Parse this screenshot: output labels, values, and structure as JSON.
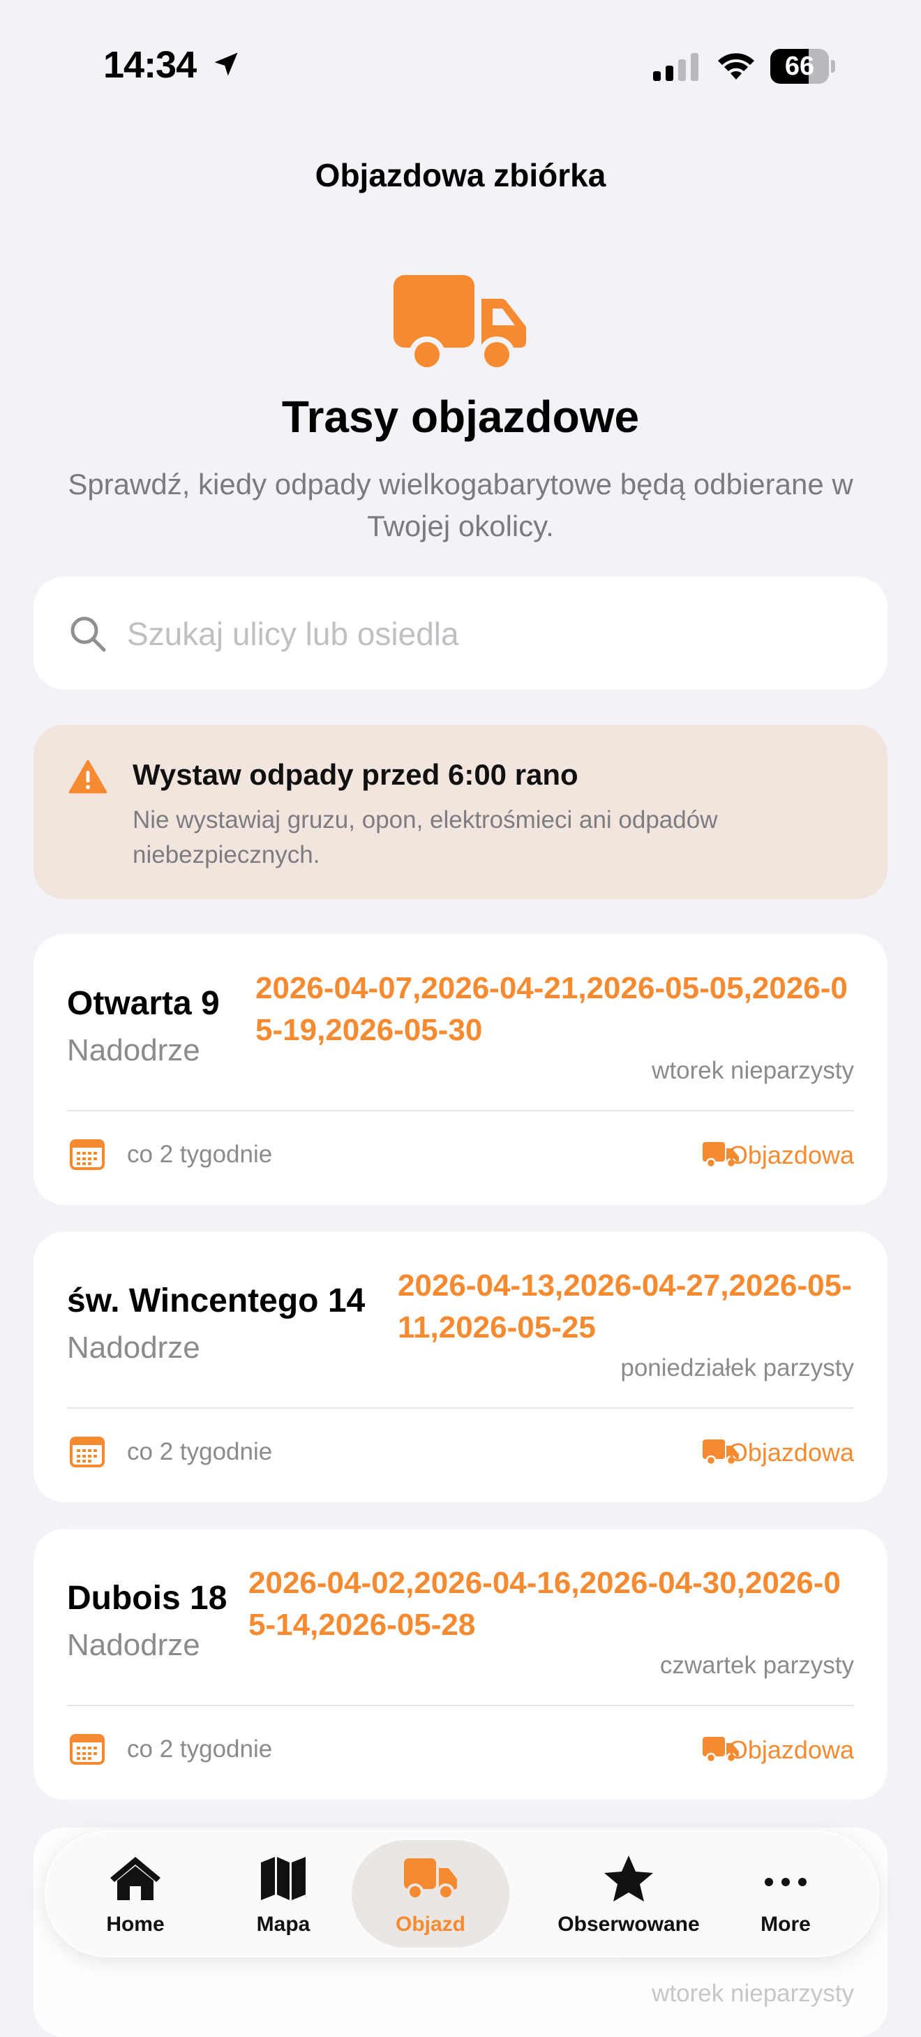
{
  "status": {
    "time": "14:34",
    "battery": "66",
    "battery_level": 0.66
  },
  "header": {
    "nav_title": "Objazdowa zbiórka",
    "hero_title": "Trasy objazdowe",
    "hero_subtitle": "Sprawdź, kiedy odpady wielkogabarytowe będą odbierane w Twojej okolicy."
  },
  "search": {
    "placeholder": "Szukaj ulicy lub osiedla",
    "value": ""
  },
  "warning": {
    "title": "Wystaw odpady przed 6:00 rano",
    "body": "Nie wystawiaj gruzu, opon, elektrośmieci ani odpadów niebezpiecznych."
  },
  "cards": [
    {
      "street": "Otwarta 9",
      "district": "Nadodrze",
      "dates": "2026-04-07,2026-04-21,2026-05-05,2026-05-19,2026-05-30",
      "day": "wtorek nieparzysty",
      "frequency": "co 2 tygodnie",
      "type": "Objazdowa"
    },
    {
      "street": "św. Wincentego 14",
      "district": "Nadodrze",
      "dates": "2026-04-13,2026-04-27,2026-05-11,2026-05-25",
      "day": "poniedziałek parzysty",
      "frequency": "co 2 tygodnie",
      "type": "Objazdowa"
    },
    {
      "street": "Dubois 18",
      "district": "Nadodrze",
      "dates": "2026-04-02,2026-04-16,2026-04-30,2026-05-14,2026-05-28",
      "day": "czwartek parzysty",
      "frequency": "co 2 tygodnie",
      "type": "Objazdowa"
    },
    {
      "day": "wtorek nieparzysty"
    }
  ],
  "tabs": [
    {
      "label": "Home",
      "icon": "house-icon",
      "active": false
    },
    {
      "label": "Mapa",
      "icon": "map-icon",
      "active": false
    },
    {
      "label": "Objazd",
      "icon": "truck-icon",
      "active": true
    },
    {
      "label": "Obserwowane",
      "icon": "star-icon",
      "active": false
    },
    {
      "label": "More",
      "icon": "ellipsis-icon",
      "active": false
    }
  ],
  "colors": {
    "accent": "#f58a30",
    "background": "#f2f2f7",
    "warning_bg": "#f2e5de"
  }
}
